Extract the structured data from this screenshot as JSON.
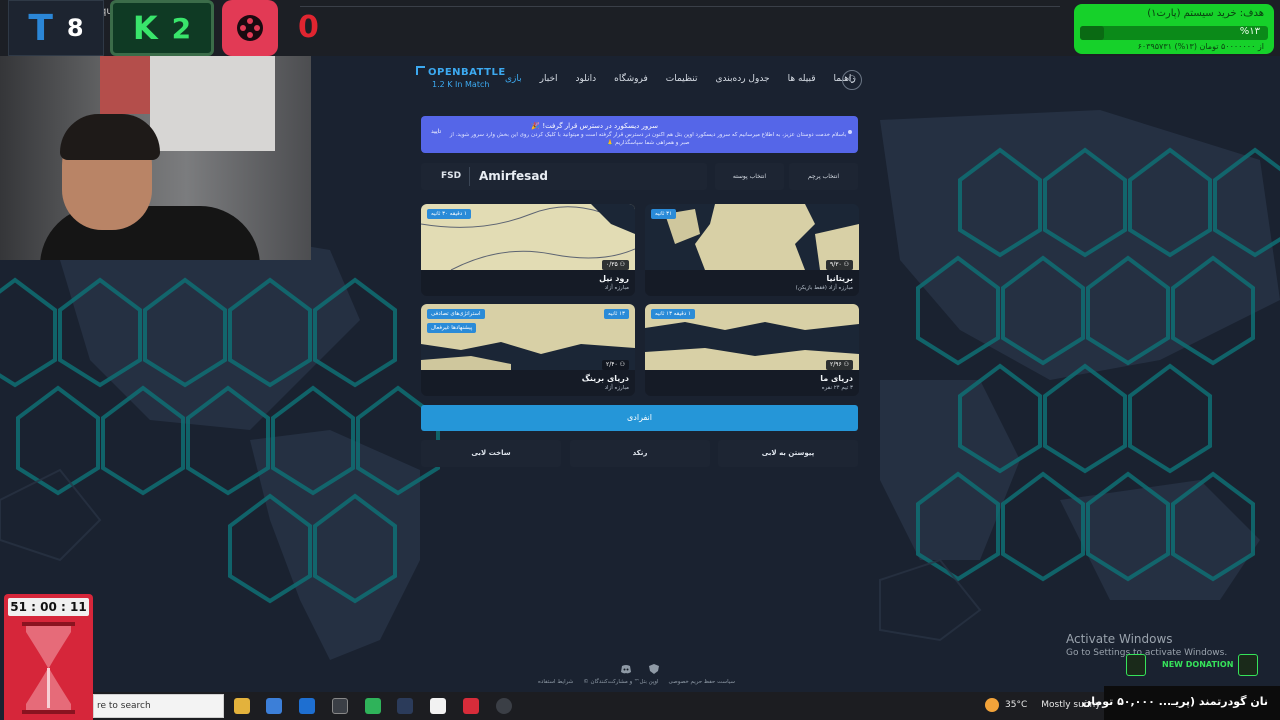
{
  "overlay": {
    "team_t_logo": "T",
    "team_t_score": "8",
    "team_k_logo": "K",
    "team_k_score": "2",
    "extra_score": "0",
    "top_small": "qu"
  },
  "goal": {
    "title": "هدف: خرید سیستم (پارت۱)",
    "percent": "%۱۳",
    "progress": 0.13,
    "subtitle": "۶۰۳۹۵۷۳۱ از ۵۰۰۰۰۰۰۰ تومان (۱۳%)"
  },
  "site": {
    "brand": "OPENBATTLE",
    "brand_sub": "1.2 K In Match",
    "nav": [
      "راهنما",
      "قبیله ها",
      "جدول رده‌بندی",
      "تنظیمات",
      "فروشگاه",
      "دانلود",
      "اخبار",
      "بازی"
    ],
    "active_nav": "بازی",
    "avatar_icon": "user-plus-icon"
  },
  "announcement": {
    "title": "سرور دیسکورد در دسترس قرار گرفت! 🎉",
    "body": "باسلام خدمت دوستان عزیز، به اطلاع میرسانیم که سرور دیسکورد اوپن بتل هم اکنون در دسترس قرار گرفته است و میتوانید با کلیک کردن روی این بخش وارد سرور شوید. از صبر و همراهی شما سپاسگذاریم 🙏",
    "close": "تایید"
  },
  "player": {
    "tag": "FSD",
    "name": "Amirfesad",
    "skin_button": "انتخاب پوسته",
    "flag_button": "انتخاب پرچم"
  },
  "maps": [
    {
      "name": "بریتانیا",
      "mode": "مبارزه آزاد (فقط بازیکن)",
      "time": "۳۱ ثانیه",
      "players": "۹/۳۰"
    },
    {
      "name": "رود نیل",
      "mode": "مبارزه آزاد",
      "time": "۱ دقیقه ۳۰ ثانیه",
      "players": "۰/۳۵"
    },
    {
      "name": "دریای ما",
      "mode": "۳ تیم ۲۴ نفره",
      "time": "۱ دقیقه ۱۳ ثانیه",
      "players": "۲/۹۶"
    },
    {
      "name": "دریای برینگ",
      "mode": "مبارزه آزاد",
      "time": "۱۳ ثانیه",
      "players": "۲/۴۰",
      "tags": [
        "استراتژی‌های تصادفی",
        "پیشنهادها غیرفعال"
      ]
    }
  ],
  "buttons": {
    "single": "انفرادی",
    "join_lobby": "پیوستن به لابی",
    "ranked": "رنکد",
    "create_lobby": "ساخت لابی"
  },
  "footer": {
    "links": [
      "سیاست حفظ حریم خصوصی",
      "اوپن‌ ‌بتل™ و مشارکت‌کنندگان ©",
      "شرایط استفاده"
    ]
  },
  "system": {
    "activate_title": "Activate Windows",
    "activate_sub": "Go to Settings to activate Windows.",
    "search_placeholder": "re to search",
    "weather_temp": "35°C",
    "weather_desc": "Mostly sunny"
  },
  "timer": {
    "value": "51 : 00 : 11"
  },
  "donation": {
    "banner": "NEW DONATION",
    "text": "نان گودرتمند (پریـ... ۵۰,۰۰۰ تومان"
  },
  "colors": {
    "accent": "#2596d8",
    "announce": "#5566e8",
    "goal_green": "#16d12a",
    "timer_red": "#d6263a"
  }
}
